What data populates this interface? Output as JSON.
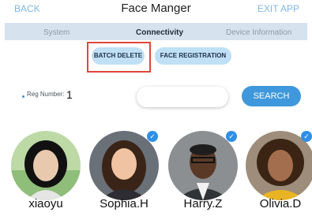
{
  "header": {
    "back": "BACK",
    "title": "Face Manger",
    "exit": "EXIT APP"
  },
  "tabs": [
    {
      "label": "System",
      "active": false
    },
    {
      "label": "Connectivity",
      "active": true
    },
    {
      "label": "Device Information",
      "active": false
    }
  ],
  "actions": {
    "batch_delete": "BATCH DELETE",
    "face_registration": "FACE REGISTRATION"
  },
  "registration": {
    "label": "Reg Number:",
    "value": "1"
  },
  "search": {
    "placeholder": "",
    "button": "SEARCH"
  },
  "users": [
    {
      "name": "xiaoyu",
      "selected": false
    },
    {
      "name": "Sophia.H",
      "selected": true
    },
    {
      "name": "Harry.Z",
      "selected": true
    },
    {
      "name": "Olivia.D",
      "selected": true
    }
  ],
  "colors": {
    "accent": "#3e98db",
    "tab_bar": "#d6e3ef",
    "pill": "#bfe0f5",
    "highlight_box": "#e0473b",
    "check": "#2f8fe6",
    "header_link": "#7eb7e6"
  }
}
